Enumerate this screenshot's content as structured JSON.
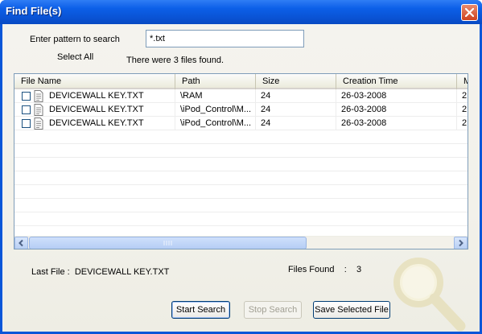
{
  "window": {
    "title": "Find File(s)"
  },
  "search": {
    "pattern_label": "Enter pattern to search",
    "pattern_value": "*.txt",
    "select_all_label": "Select All",
    "result_message": "There were 3 files found."
  },
  "list": {
    "columns": [
      "File Name",
      "Path",
      "Size",
      "Creation Time",
      "M"
    ],
    "rows": [
      {
        "name": "DEVICEWALL KEY.TXT",
        "path": "\\RAM",
        "size": "24",
        "created": "26-03-2008",
        "extra": "2"
      },
      {
        "name": "DEVICEWALL KEY.TXT",
        "path": "\\iPod_Control\\M...",
        "size": "24",
        "created": "26-03-2008",
        "extra": "2"
      },
      {
        "name": "DEVICEWALL KEY.TXT",
        "path": "\\iPod_Control\\M...",
        "size": "24",
        "created": "26-03-2008",
        "extra": "2"
      }
    ]
  },
  "status": {
    "last_file_label": "Last File  :",
    "last_file_value": "DEVICEWALL KEY.TXT",
    "files_found_label": "Files Found",
    "files_found_sep": ":",
    "files_found_value": "3"
  },
  "buttons": {
    "start_search": "Start Search",
    "stop_search": "Stop Search",
    "save_selected": "Save Selected File"
  }
}
